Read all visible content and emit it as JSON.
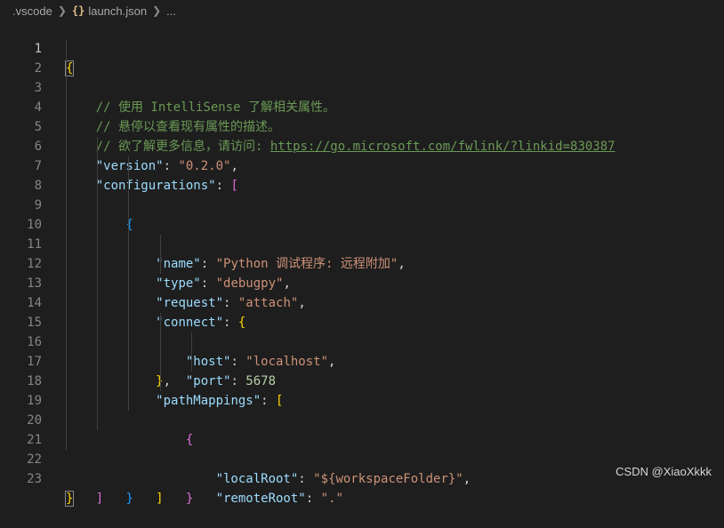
{
  "breadcrumb": {
    "folder": ".vscode",
    "json_icon": "{}",
    "file": "launch.json",
    "ellipsis": "..."
  },
  "lines": {
    "n1": "1",
    "n2": "2",
    "n3": "3",
    "n4": "4",
    "n5": "5",
    "n6": "6",
    "n7": "7",
    "n8": "8",
    "n9": "9",
    "n10": "10",
    "n11": "11",
    "n12": "12",
    "n13": "13",
    "n14": "14",
    "n15": "15",
    "n16": "16",
    "n17": "17",
    "n18": "18",
    "n19": "19",
    "n20": "20",
    "n21": "21",
    "n22": "22",
    "n23": "23"
  },
  "code": {
    "comment1": "// 使用 IntelliSense 了解相关属性。",
    "comment2": "// 悬停以查看现有属性的描述。",
    "comment3_prefix": "// 欲了解更多信息，请访问: ",
    "comment3_link": "https://go.microsoft.com/fwlink/?linkid=830387",
    "version_key": "\"version\"",
    "version_val": "\"0.2.0\"",
    "configurations_key": "\"configurations\"",
    "name_key": "\"name\"",
    "name_val": "\"Python 调试程序: 远程附加\"",
    "type_key": "\"type\"",
    "type_val": "\"debugpy\"",
    "request_key": "\"request\"",
    "request_val": "\"attach\"",
    "connect_key": "\"connect\"",
    "host_key": "\"host\"",
    "host_val": "\"localhost\"",
    "port_key": "\"port\"",
    "port_val": "5678",
    "pathMappings_key": "\"pathMappings\"",
    "localRoot_key": "\"localRoot\"",
    "localRoot_val": "\"${workspaceFolder}\"",
    "remoteRoot_key": "\"remoteRoot\"",
    "remoteRoot_val": "\".\""
  },
  "watermark": "CSDN @XiaoXkkk",
  "colors": {
    "background": "#1e1e1e",
    "comment": "#6a9955",
    "key": "#9cdcfe",
    "string": "#ce9178",
    "number": "#b5cea8",
    "bracket_level1": "#ffd700",
    "bracket_level2": "#da70d6",
    "bracket_level3": "#179fff"
  }
}
